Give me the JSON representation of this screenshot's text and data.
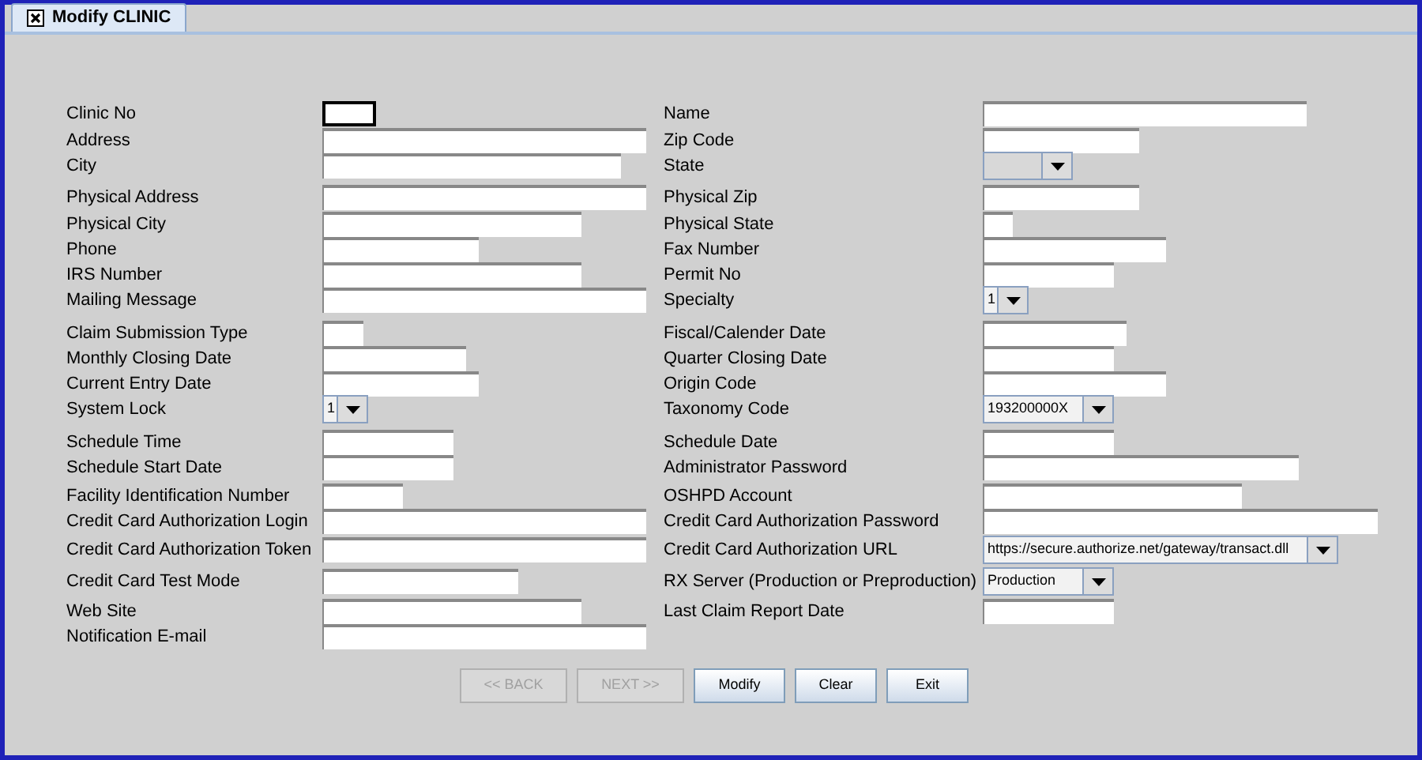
{
  "tab": {
    "label": "Modify CLINIC",
    "selected": true
  },
  "rows": [
    {
      "left": {
        "label": "Clinic No",
        "field": {
          "kind": "text",
          "focused": true
        }
      },
      "right": {
        "label": "Name",
        "field": {
          "kind": "text",
          "focused": false
        }
      }
    },
    {
      "left": {
        "label": "Address",
        "field": {
          "kind": "text",
          "focused": false
        }
      },
      "right": {
        "label": "Zip Code",
        "field": {
          "kind": "text",
          "focused": false
        }
      }
    },
    {
      "left": {
        "label": "City",
        "field": {
          "kind": "text",
          "focused": false
        }
      },
      "right": {
        "label": "State",
        "field": {
          "kind": "combo",
          "focused": false
        }
      }
    },
    {
      "left": {
        "label": "Physical Address",
        "field": {
          "kind": "text",
          "focused": false
        }
      },
      "right": {
        "label": "Physical Zip",
        "field": {
          "kind": "text",
          "focused": false
        }
      }
    },
    {
      "left": {
        "label": "Physical City",
        "field": {
          "kind": "text",
          "focused": false
        }
      },
      "right": {
        "label": "Physical State",
        "field": {
          "kind": "text",
          "focused": false
        }
      }
    },
    {
      "left": {
        "label": "Phone",
        "field": {
          "kind": "text",
          "focused": false
        }
      },
      "right": {
        "label": "Fax Number",
        "field": {
          "kind": "text",
          "focused": false
        }
      }
    },
    {
      "left": {
        "label": "IRS Number",
        "field": {
          "kind": "text",
          "focused": false
        }
      },
      "right": {
        "label": "Permit No",
        "field": {
          "kind": "text",
          "focused": false
        }
      }
    },
    {
      "left": {
        "label": "Mailing Message",
        "field": {
          "kind": "text",
          "focused": false
        }
      },
      "right": {
        "label": "Specialty",
        "field": {
          "kind": "combo",
          "value": "1",
          "focused": false
        }
      }
    },
    {
      "left": {
        "label": "Claim Submission Type",
        "field": {
          "kind": "text",
          "focused": false
        }
      },
      "right": {
        "label": "Fiscal/Calender Date",
        "field": {
          "kind": "text",
          "focused": false
        }
      }
    },
    {
      "left": {
        "label": "Monthly Closing Date",
        "field": {
          "kind": "text",
          "focused": false
        }
      },
      "right": {
        "label": "Quarter Closing Date",
        "field": {
          "kind": "text",
          "focused": false
        }
      }
    },
    {
      "left": {
        "label": "Current Entry Date",
        "field": {
          "kind": "text",
          "focused": false
        }
      },
      "right": {
        "label": "Origin Code",
        "field": {
          "kind": "text",
          "focused": false
        }
      }
    },
    {
      "left": {
        "label": "System Lock",
        "field": {
          "kind": "combo",
          "value": "1",
          "focused": false
        }
      },
      "right": {
        "label": "Taxonomy Code",
        "field": {
          "kind": "combo",
          "value": "193200000X",
          "focused": false
        }
      }
    },
    {
      "left": {
        "label": "Schedule Time",
        "field": {
          "kind": "text",
          "focused": false
        }
      },
      "right": {
        "label": "Schedule Date",
        "field": {
          "kind": "text",
          "focused": false
        }
      }
    },
    {
      "left": {
        "label": "Schedule Start Date",
        "field": {
          "kind": "text",
          "focused": false
        }
      },
      "right": {
        "label": "Administrator Password",
        "field": {
          "kind": "text",
          "focused": false
        }
      }
    },
    {
      "left": {
        "label": "Facility Identification Number",
        "field": {
          "kind": "text",
          "focused": false
        }
      },
      "right": {
        "label": "OSHPD Account",
        "field": {
          "kind": "text",
          "focused": false
        }
      }
    },
    {
      "left": {
        "label": "Credit Card Authorization Login",
        "field": {
          "kind": "text",
          "focused": false
        }
      },
      "right": {
        "label": "Credit Card Authorization Password",
        "field": {
          "kind": "text",
          "focused": false
        }
      }
    },
    {
      "left": {
        "label": "Credit Card Authorization Token",
        "field": {
          "kind": "text",
          "focused": false
        }
      },
      "right": {
        "label": "Credit Card Authorization URL",
        "field": {
          "kind": "combo",
          "value": "https://secure.authorize.net/gateway/transact.dll",
          "focused": false
        }
      }
    },
    {
      "left": {
        "label": "Credit Card Test Mode",
        "field": {
          "kind": "text",
          "focused": false
        }
      },
      "right": {
        "label": "RX Server (Production or Preproduction)",
        "field": {
          "kind": "combo",
          "value": "Production",
          "focused": false
        }
      }
    },
    {
      "left": {
        "label": "Web Site",
        "field": {
          "kind": "text",
          "focused": false
        }
      },
      "right": {
        "label": "Last Claim Report Date",
        "field": {
          "kind": "text",
          "focused": false
        }
      }
    },
    {
      "left": {
        "label": "Notification E-mail",
        "field": {
          "kind": "text",
          "focused": false
        }
      }
    }
  ],
  "buttons": [
    {
      "label": "<< BACK",
      "disabled": true
    },
    {
      "label": "NEXT >>",
      "disabled": true
    },
    {
      "label": "Modify",
      "disabled": false
    },
    {
      "label": "Clear",
      "disabled": false
    },
    {
      "label": "Exit",
      "disabled": false
    }
  ]
}
